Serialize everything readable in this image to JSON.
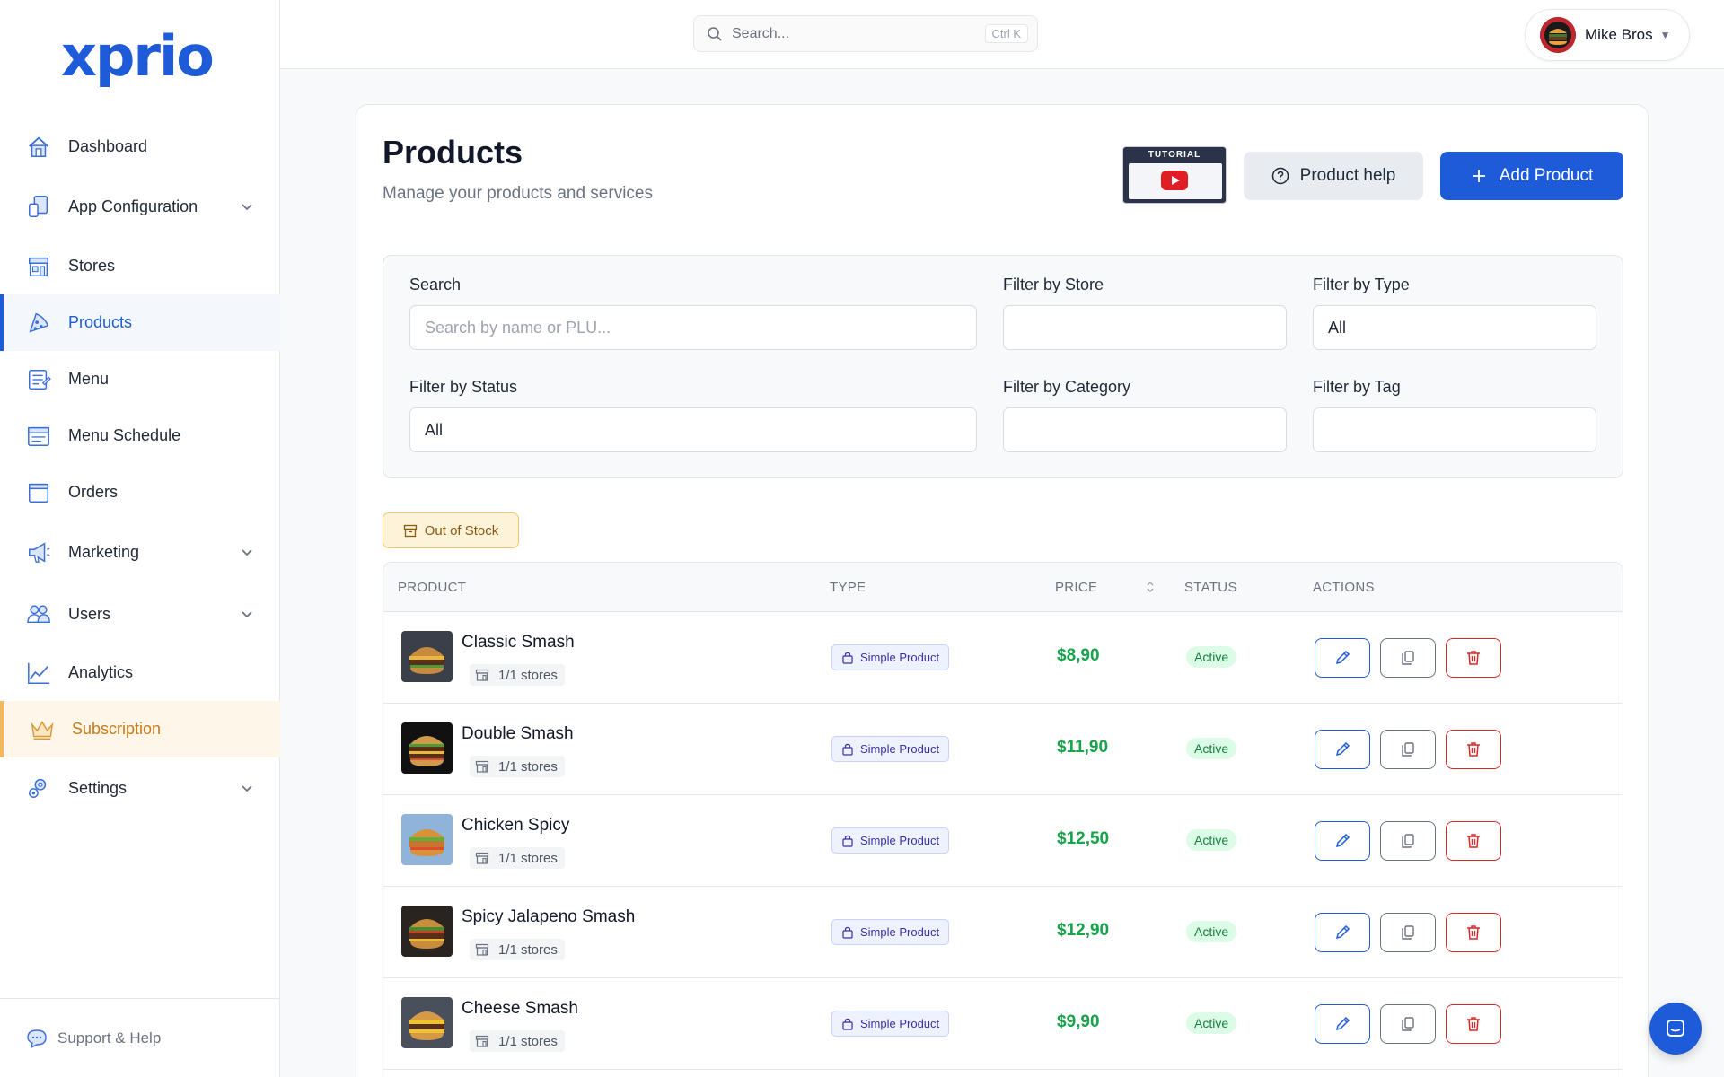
{
  "app": {
    "logo": "xprio"
  },
  "sidebar": {
    "items": [
      {
        "label": "Dashboard",
        "icon": "home-icon"
      },
      {
        "label": "App Configuration",
        "icon": "devices-icon",
        "expandable": true
      },
      {
        "label": "Stores",
        "icon": "store-icon"
      },
      {
        "label": "Products",
        "icon": "pizza-icon",
        "active": true
      },
      {
        "label": "Menu",
        "icon": "menu-book-icon"
      },
      {
        "label": "Menu Schedule",
        "icon": "calendar-icon"
      },
      {
        "label": "Orders",
        "icon": "box-icon"
      },
      {
        "label": "Marketing",
        "icon": "megaphone-icon",
        "expandable": true
      },
      {
        "label": "Users",
        "icon": "users-icon",
        "expandable": true
      },
      {
        "label": "Analytics",
        "icon": "chart-icon"
      },
      {
        "label": "Subscription",
        "icon": "crown-icon",
        "highlight": true
      },
      {
        "label": "Settings",
        "icon": "gear-icon",
        "expandable": true
      }
    ],
    "support_label": "Support & Help"
  },
  "topbar": {
    "search_placeholder": "Search...",
    "search_shortcut": "Ctrl K",
    "user_name": "Mike Bros"
  },
  "page": {
    "title": "Products",
    "subtitle": "Manage your products and services",
    "tutorial_label": "TUTORIAL",
    "help_button": "Product help",
    "add_button": "Add Product"
  },
  "filters": {
    "search_label": "Search",
    "search_placeholder": "Search by name or PLU...",
    "store_label": "Filter by Store",
    "store_value": "",
    "type_label": "Filter by Type",
    "type_value": "All",
    "status_label": "Filter by Status",
    "status_value": "All",
    "category_label": "Filter by Category",
    "category_value": "",
    "tag_label": "Filter by Tag",
    "tag_value": ""
  },
  "out_of_stock_label": "Out of Stock",
  "table": {
    "headers": {
      "product": "PRODUCT",
      "type": "TYPE",
      "price": "PRICE",
      "status": "STATUS",
      "actions": "ACTIONS"
    },
    "rows": [
      {
        "name": "Classic Smash",
        "stores": "1/1 stores",
        "type": "Simple Product",
        "price": "$8,90",
        "status": "Active"
      },
      {
        "name": "Double Smash",
        "stores": "1/1 stores",
        "type": "Simple Product",
        "price": "$11,90",
        "status": "Active"
      },
      {
        "name": "Chicken Spicy",
        "stores": "1/1 stores",
        "type": "Simple Product",
        "price": "$12,50",
        "status": "Active"
      },
      {
        "name": "Spicy Jalapeno Smash",
        "stores": "1/1 stores",
        "type": "Simple Product",
        "price": "$12,90",
        "status": "Active"
      },
      {
        "name": "Cheese Smash",
        "stores": "1/1 stores",
        "type": "Simple Product",
        "price": "$9,90",
        "status": "Active"
      }
    ]
  },
  "colors": {
    "primary": "#1d5bd8",
    "price": "#16a34a",
    "danger": "#dc2626",
    "subscription": "#c97a17"
  }
}
